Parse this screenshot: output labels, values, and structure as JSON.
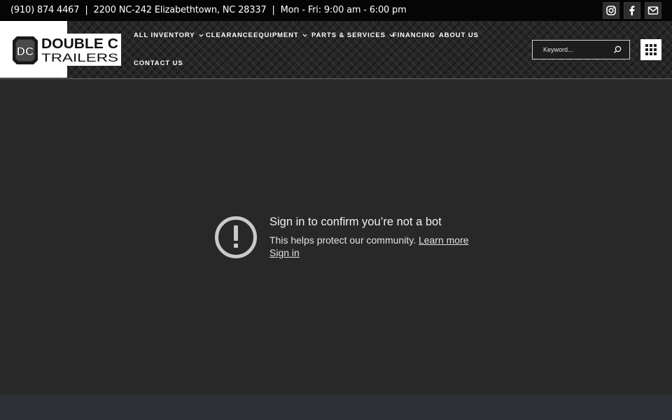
{
  "topbar": {
    "phone": "(910) 874 4467",
    "address": "2200 NC-242 Elizabethtown, NC 28337",
    "hours": "Mon - Fri: 9:00 am - 6:00 pm",
    "separator": "|",
    "socials": [
      {
        "icon": "instagram-icon"
      },
      {
        "icon": "facebook-icon"
      },
      {
        "icon": "envelope-icon"
      }
    ]
  },
  "logo": {
    "line1": "DOUBLE C",
    "line2": "TRAILERS",
    "badge": "DC"
  },
  "nav": {
    "items": [
      {
        "label": "ALL INVENTORY",
        "dropdown": true
      },
      {
        "label": "CLEARANCE",
        "dropdown": false
      },
      {
        "label": "EQUIPMENT",
        "dropdown": true
      },
      {
        "label": "PARTS & SERVICES",
        "dropdown": true
      },
      {
        "label": "FINANCING",
        "dropdown": false
      },
      {
        "label": "ABOUT US",
        "dropdown": false
      },
      {
        "label": "CONTACT US",
        "dropdown": false
      }
    ]
  },
  "search": {
    "placeholder": "Keyword..."
  },
  "notice": {
    "title": "Sign in to confirm you’re not a bot",
    "body": "This helps protect our community.",
    "learn_more": "Learn more",
    "sign_in": "Sign in"
  },
  "colors": {
    "topbar": "#050505",
    "page_bg": "#282828",
    "footer": "#2d3035"
  }
}
